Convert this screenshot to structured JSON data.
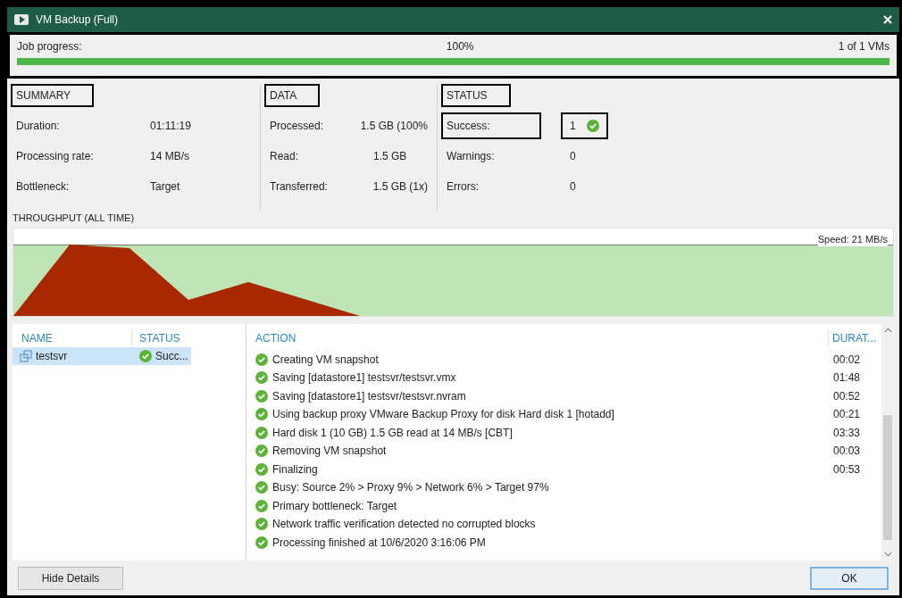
{
  "window": {
    "title": "VM Backup (Full)"
  },
  "job_progress": {
    "label": "Job progress:",
    "percent": "100%",
    "count": "1 of 1 VMs",
    "level": 1,
    "highlighted": true
  },
  "stats": [
    {
      "heading": "SUMMARY",
      "highlighted": true,
      "rows": [
        {
          "label": "Duration:",
          "value": "01:11:19",
          "label_highlighted": false,
          "value_highlighted": false
        },
        {
          "label": "Processing rate:",
          "value": "14 MB/s",
          "label_highlighted": false,
          "value_highlighted": false
        },
        {
          "label": "Bottleneck:",
          "value": "Target",
          "label_highlighted": false,
          "value_highlighted": false
        }
      ]
    },
    {
      "heading": "DATA",
      "highlighted": true,
      "rows": [
        {
          "label": "Processed:",
          "value": "1.5 GB (100%",
          "label_highlighted": false,
          "value_highlighted": false
        },
        {
          "label": "Read:",
          "value": "1.5 GB",
          "label_highlighted": false,
          "value_highlighted": false
        },
        {
          "label": "Transferred:",
          "value": "1.5 GB (1x)",
          "label_highlighted": false,
          "value_highlighted": false
        }
      ]
    },
    {
      "heading": "STATUS",
      "highlighted": true,
      "rows": [
        {
          "label": "Success:",
          "value": "1",
          "label_highlighted": true,
          "value_highlighted": true,
          "ok": true
        },
        {
          "label": "Warnings:",
          "value": "0",
          "label_highlighted": false,
          "value_highlighted": false,
          "ok": false
        },
        {
          "label": "Errors:",
          "value": "0",
          "label_highlighted": false,
          "value_highlighted": false,
          "ok": false
        }
      ]
    }
  ],
  "throughput": {
    "title": "THROUGHPUT (ALL TIME)",
    "speed": "Speed: 21 MB/s"
  },
  "vm_table": {
    "columns": [
      "NAME",
      "STATUS"
    ],
    "rows": [
      {
        "name": "testsvr",
        "status": "Succ...",
        "selected": true
      }
    ]
  },
  "action_table": {
    "columns": [
      "ACTION",
      "DURAT..."
    ],
    "rows": [
      {
        "action": "Creating VM snapshot",
        "duration": "00:02"
      },
      {
        "action": "Saving [datastore1] testsvr/testsvr.vmx",
        "duration": "01:48"
      },
      {
        "action": "Saving [datastore1] testsvr/testsvr.nvram",
        "duration": "00:52"
      },
      {
        "action": "Using backup proxy VMware Backup Proxy for disk Hard disk 1 [hotadd]",
        "duration": "00:21"
      },
      {
        "action": "Hard disk 1 (10 GB) 1.5 GB read at 14 MB/s [CBT]",
        "duration": "03:33"
      },
      {
        "action": "Removing VM snapshot",
        "duration": "00:03"
      },
      {
        "action": "Finalizing",
        "duration": "00:53"
      },
      {
        "action": "Busy: Source 2% > Proxy 9% > Network 6% > Target 97%",
        "duration": ""
      },
      {
        "action": "Primary bottleneck: Target",
        "duration": ""
      },
      {
        "action": "Network traffic verification detected no corrupted blocks",
        "duration": ""
      },
      {
        "action": "Processing finished at 10/6/2020 3:16:06 PM",
        "duration": ""
      }
    ]
  },
  "buttons": {
    "left": "Hide Details",
    "right": "OK"
  }
}
